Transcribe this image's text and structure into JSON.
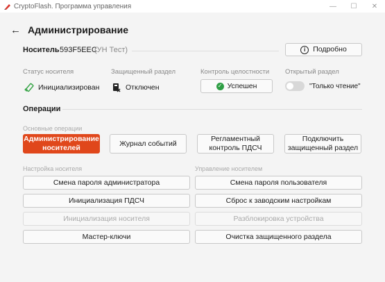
{
  "window": {
    "title": "CryptoFlash. Программа управления"
  },
  "header": {
    "back_arrow": "←",
    "title": "Администрирование"
  },
  "carrier": {
    "label": "Носитель",
    "id": "593F5EEC",
    "type": "(УН Тест)",
    "details_button": "Подробно"
  },
  "status": {
    "carrier_status": {
      "label": "Статус носителя",
      "value": "Инициализирован"
    },
    "protected_section": {
      "label": "Защищенный раздел",
      "value": "Отключен"
    },
    "integrity": {
      "label": "Контроль целостности",
      "value": "Успешен"
    },
    "open_section": {
      "label": "Открытый раздел",
      "value": "\"Только чтение\""
    }
  },
  "operations": {
    "title": "Операции",
    "basic": {
      "label": "Основные операции",
      "buttons": [
        "Администрирование носителей",
        "Журнал событий",
        "Регламентный контроль ПДСЧ",
        "Подключить защищенный раздел"
      ]
    },
    "carrier_setup": {
      "label": "Настройка носителя",
      "buttons": [
        "Смена пароля администратора",
        "Инициализация ПДСЧ",
        "Инициализация носителя",
        "Мастер-ключи"
      ]
    },
    "carrier_management": {
      "label": "Управление носителем",
      "buttons": [
        "Смена пароля пользователя",
        "Сброс к заводским настройкам",
        "Разблокировка устройства",
        "Очистка защищенного раздела"
      ]
    }
  },
  "colors": {
    "accent": "#e0471b",
    "success": "#2e9e44"
  }
}
